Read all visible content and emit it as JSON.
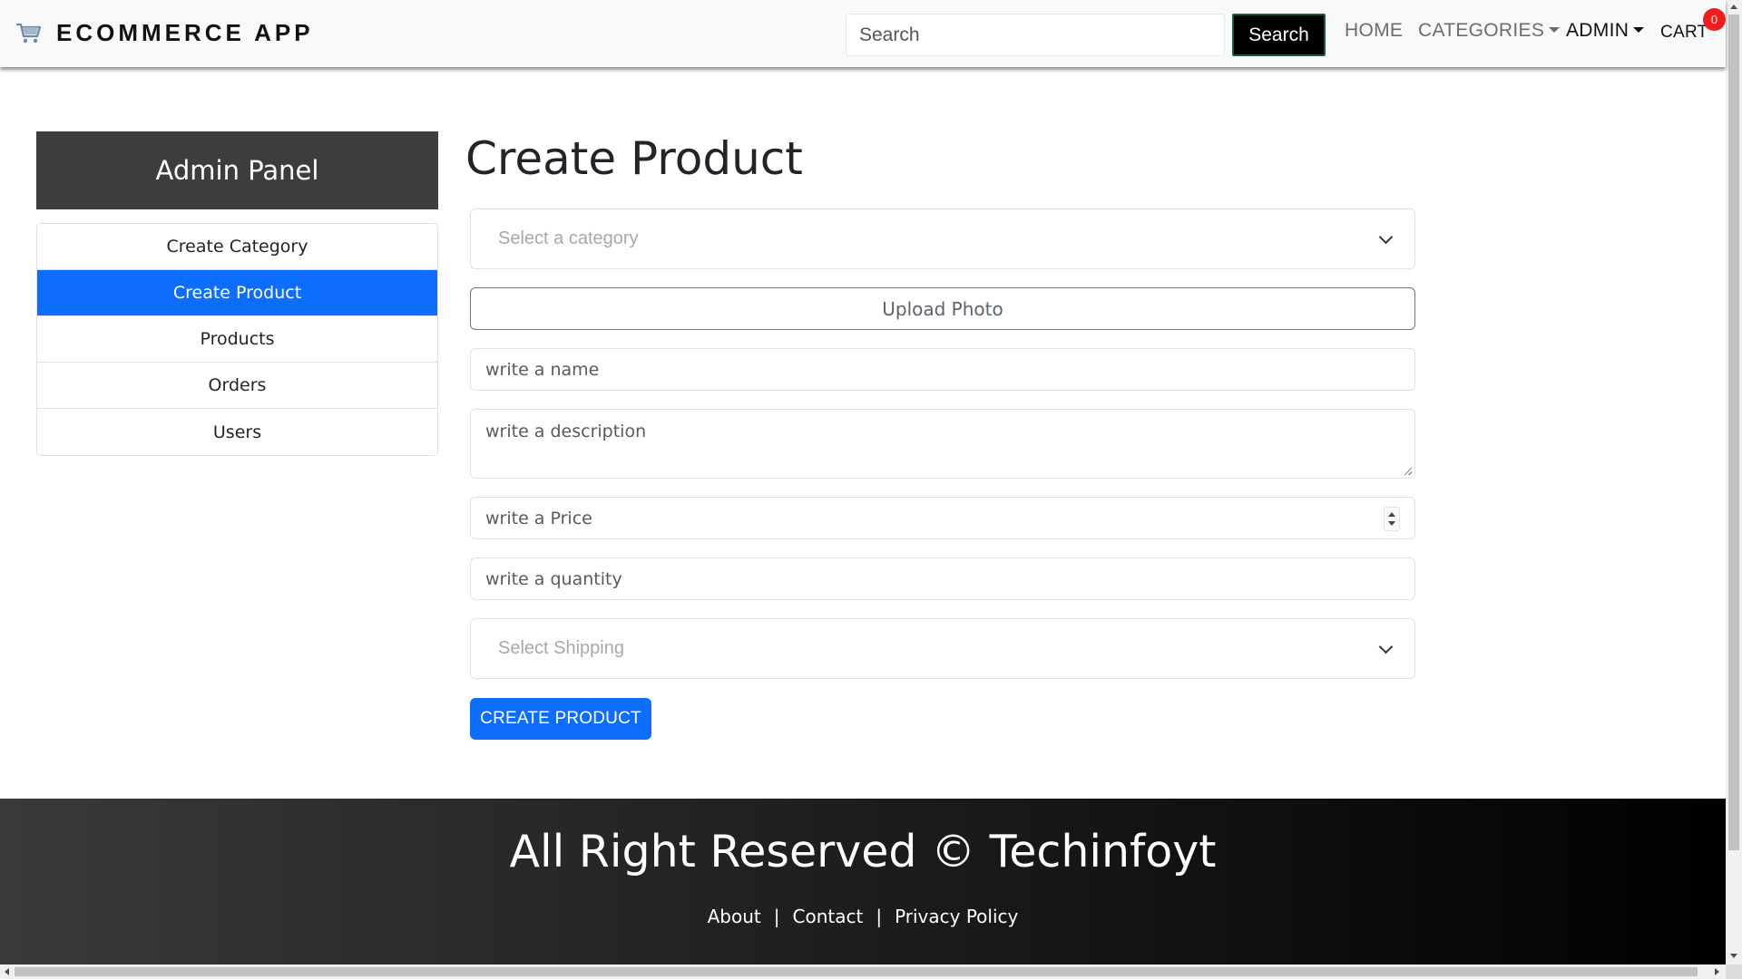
{
  "navbar": {
    "brand": "ECOMMERCE APP",
    "brand_icon": "shopping-cart-icon",
    "search_placeholder": "Search",
    "search_button": "Search",
    "links": {
      "home": "HOME",
      "categories": "CATEGORIES",
      "admin": "ADMIN",
      "cart": "CART"
    },
    "cart_count": "0"
  },
  "sidebar": {
    "title": "Admin Panel",
    "items": [
      {
        "label": "Create Category"
      },
      {
        "label": "Create Product"
      },
      {
        "label": "Products"
      },
      {
        "label": "Orders"
      },
      {
        "label": "Users"
      }
    ]
  },
  "form": {
    "title": "Create Product",
    "category_placeholder": "Select a category",
    "upload_label": "Upload Photo",
    "name_placeholder": "write a name",
    "description_placeholder": "write a description",
    "price_placeholder": "write a Price",
    "quantity_placeholder": "write a quantity",
    "shipping_placeholder": "Select Shipping",
    "submit_label": "CREATE PRODUCT"
  },
  "footer": {
    "text": "All Right Reserved © Techinfoyt",
    "links": [
      "About",
      "Contact",
      "Privacy Policy"
    ],
    "separator": "|"
  },
  "colors": {
    "primary": "#0d6efd",
    "panel_header": "#3d3d3d",
    "badge": "#f01e1e"
  }
}
